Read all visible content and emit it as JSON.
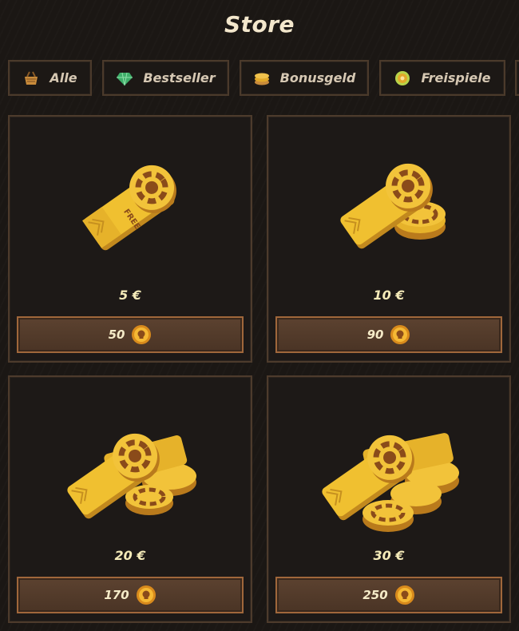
{
  "header": {
    "title": "Store"
  },
  "tabs": [
    {
      "label": "Alle",
      "icon": "basket-icon"
    },
    {
      "label": "Bestseller",
      "icon": "gem-icon"
    },
    {
      "label": "Bonusgeld",
      "icon": "coins-stack-icon"
    },
    {
      "label": "Freispiele",
      "icon": "spin-icon"
    }
  ],
  "products": [
    {
      "price": "5 €",
      "cost": "50",
      "art": "free-bet-ticket-single"
    },
    {
      "price": "10 €",
      "cost": "90",
      "art": "free-bet-ticket-with-chips"
    },
    {
      "price": "20 €",
      "cost": "170",
      "art": "free-bet-tickets-pile"
    },
    {
      "price": "30 €",
      "cost": "250",
      "art": "free-bet-tickets-large-pile"
    }
  ],
  "colors": {
    "accent": "#a0673b",
    "gold": "#e2a92a",
    "text": "#f5ebb9"
  }
}
